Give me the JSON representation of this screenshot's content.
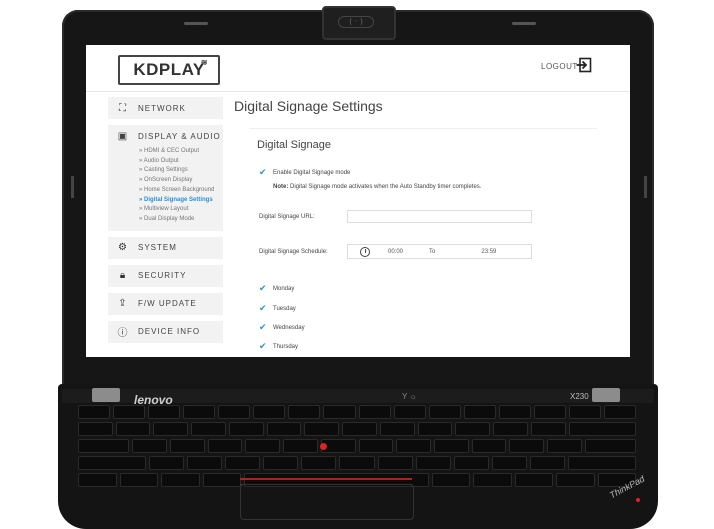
{
  "app": {
    "logo_text": "KDPLAY",
    "logout_label": "LOGOUT"
  },
  "sidebar": {
    "items": [
      {
        "label": "NETWORK",
        "icon": "network-icon"
      },
      {
        "label": "DISPLAY & AUDIO",
        "icon": "display-icon"
      },
      {
        "label": "SYSTEM",
        "icon": "gear-icon"
      },
      {
        "label": "SECURITY",
        "icon": "lock-icon"
      },
      {
        "label": "F/W UPDATE",
        "icon": "upload-icon"
      },
      {
        "label": "DEVICE INFO",
        "icon": "info-icon"
      }
    ],
    "display_audio_sub": [
      "» HDMI & CEC Output",
      "» Audio Output",
      "» Casting Settings",
      "» OnScreen Display",
      "» Home Screen Background",
      "» Digital Signage Settings",
      "» Multiview Layout",
      "» Dual Display Mode"
    ],
    "active_sub_index": 5
  },
  "main": {
    "page_title": "Digital Signage Settings",
    "card_title": "Digital Signage",
    "enable_label": "Enable Digital Signage mode",
    "note_bold": "Note:",
    "note_text": " Digital Signage mode activates when the Auto Standby timer completes.",
    "url_label": "Digital Signage URL:",
    "url_value": "",
    "schedule_label": "Digital Signage Schedule:",
    "schedule_start": "00:00",
    "schedule_to": "To",
    "schedule_end": "23:59",
    "days": [
      "Monday",
      "Tuesday",
      "Wednesday",
      "Thursday"
    ]
  },
  "laptop": {
    "brand": "lenovo",
    "model": "X230",
    "sub_brand": "ThinkPad",
    "led_indicators": "Y  ☼"
  },
  "colors": {
    "accent": "#2a8fd6",
    "trackpoint": "#dd2222"
  }
}
